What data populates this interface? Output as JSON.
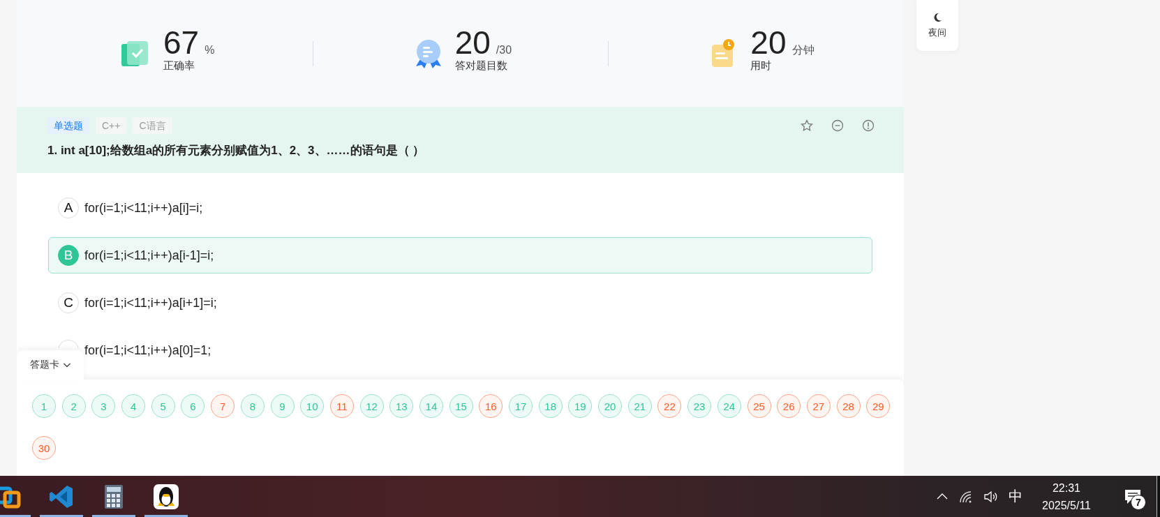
{
  "stats": [
    {
      "kind": "accuracy",
      "value": "67",
      "unit": "%",
      "label": "正确率"
    },
    {
      "kind": "correct_count",
      "value": "20",
      "unit": "/30",
      "label": "答对题目数"
    },
    {
      "kind": "time",
      "value": "20",
      "unit": "分钟",
      "label": "用时"
    }
  ],
  "side_button": {
    "label": "夜间"
  },
  "question": {
    "tags": [
      {
        "label": "单选题",
        "kind": "type"
      },
      {
        "label": "C++",
        "kind": "topic"
      },
      {
        "label": "C语言",
        "kind": "topic"
      }
    ],
    "title": "1. int a[10];给数组a的所有元素分别赋值为1、2、3、……的语句是（ ）",
    "options": [
      {
        "letter": "A",
        "text": "for(i=1;i<11;i++)a[i]=i;",
        "selected": false
      },
      {
        "letter": "B",
        "text": "for(i=1;i<11;i++)a[i-1]=i;",
        "selected": true
      },
      {
        "letter": "C",
        "text": "for(i=1;i<11;i++)a[i+1]=i;",
        "selected": false
      },
      {
        "text": "for(i=1;i<11;i++)a[0]=1;",
        "selected": false
      }
    ]
  },
  "answer_card": {
    "title": "答题卡",
    "expanded": true,
    "items": [
      {
        "label": "1",
        "correct": true
      },
      {
        "label": "2",
        "correct": true
      },
      {
        "label": "3",
        "correct": true
      },
      {
        "label": "4",
        "correct": true
      },
      {
        "label": "5",
        "correct": true
      },
      {
        "label": "6",
        "correct": true
      },
      {
        "label": "7",
        "correct": false
      },
      {
        "label": "8",
        "correct": true
      },
      {
        "label": "9",
        "correct": true
      },
      {
        "label": "10",
        "correct": true
      },
      {
        "label": "11",
        "correct": false
      },
      {
        "label": "12",
        "correct": true
      },
      {
        "label": "13",
        "correct": true
      },
      {
        "label": "14",
        "correct": true
      },
      {
        "label": "15",
        "correct": true
      },
      {
        "label": "16",
        "correct": false
      },
      {
        "label": "17",
        "correct": true
      },
      {
        "label": "18",
        "correct": true
      },
      {
        "label": "19",
        "correct": true
      },
      {
        "label": "20",
        "correct": true
      },
      {
        "label": "21",
        "correct": true
      },
      {
        "label": "22",
        "correct": false
      },
      {
        "label": "23",
        "correct": true
      },
      {
        "label": "24",
        "correct": true
      },
      {
        "label": "25",
        "correct": false
      },
      {
        "label": "26",
        "correct": false
      },
      {
        "label": "27",
        "correct": false
      },
      {
        "label": "28",
        "correct": false
      },
      {
        "label": "29",
        "correct": false
      },
      {
        "label": "30",
        "correct": false
      }
    ]
  },
  "taskbar": {
    "apps": [
      {
        "kind": "boxes",
        "running": true
      },
      {
        "kind": "editor",
        "running": true
      },
      {
        "kind": "calculator",
        "running": true
      },
      {
        "kind": "bird",
        "running": true
      }
    ],
    "ime": "中",
    "time": "22:31",
    "date": "2025/5/11",
    "notifications": "7"
  }
}
